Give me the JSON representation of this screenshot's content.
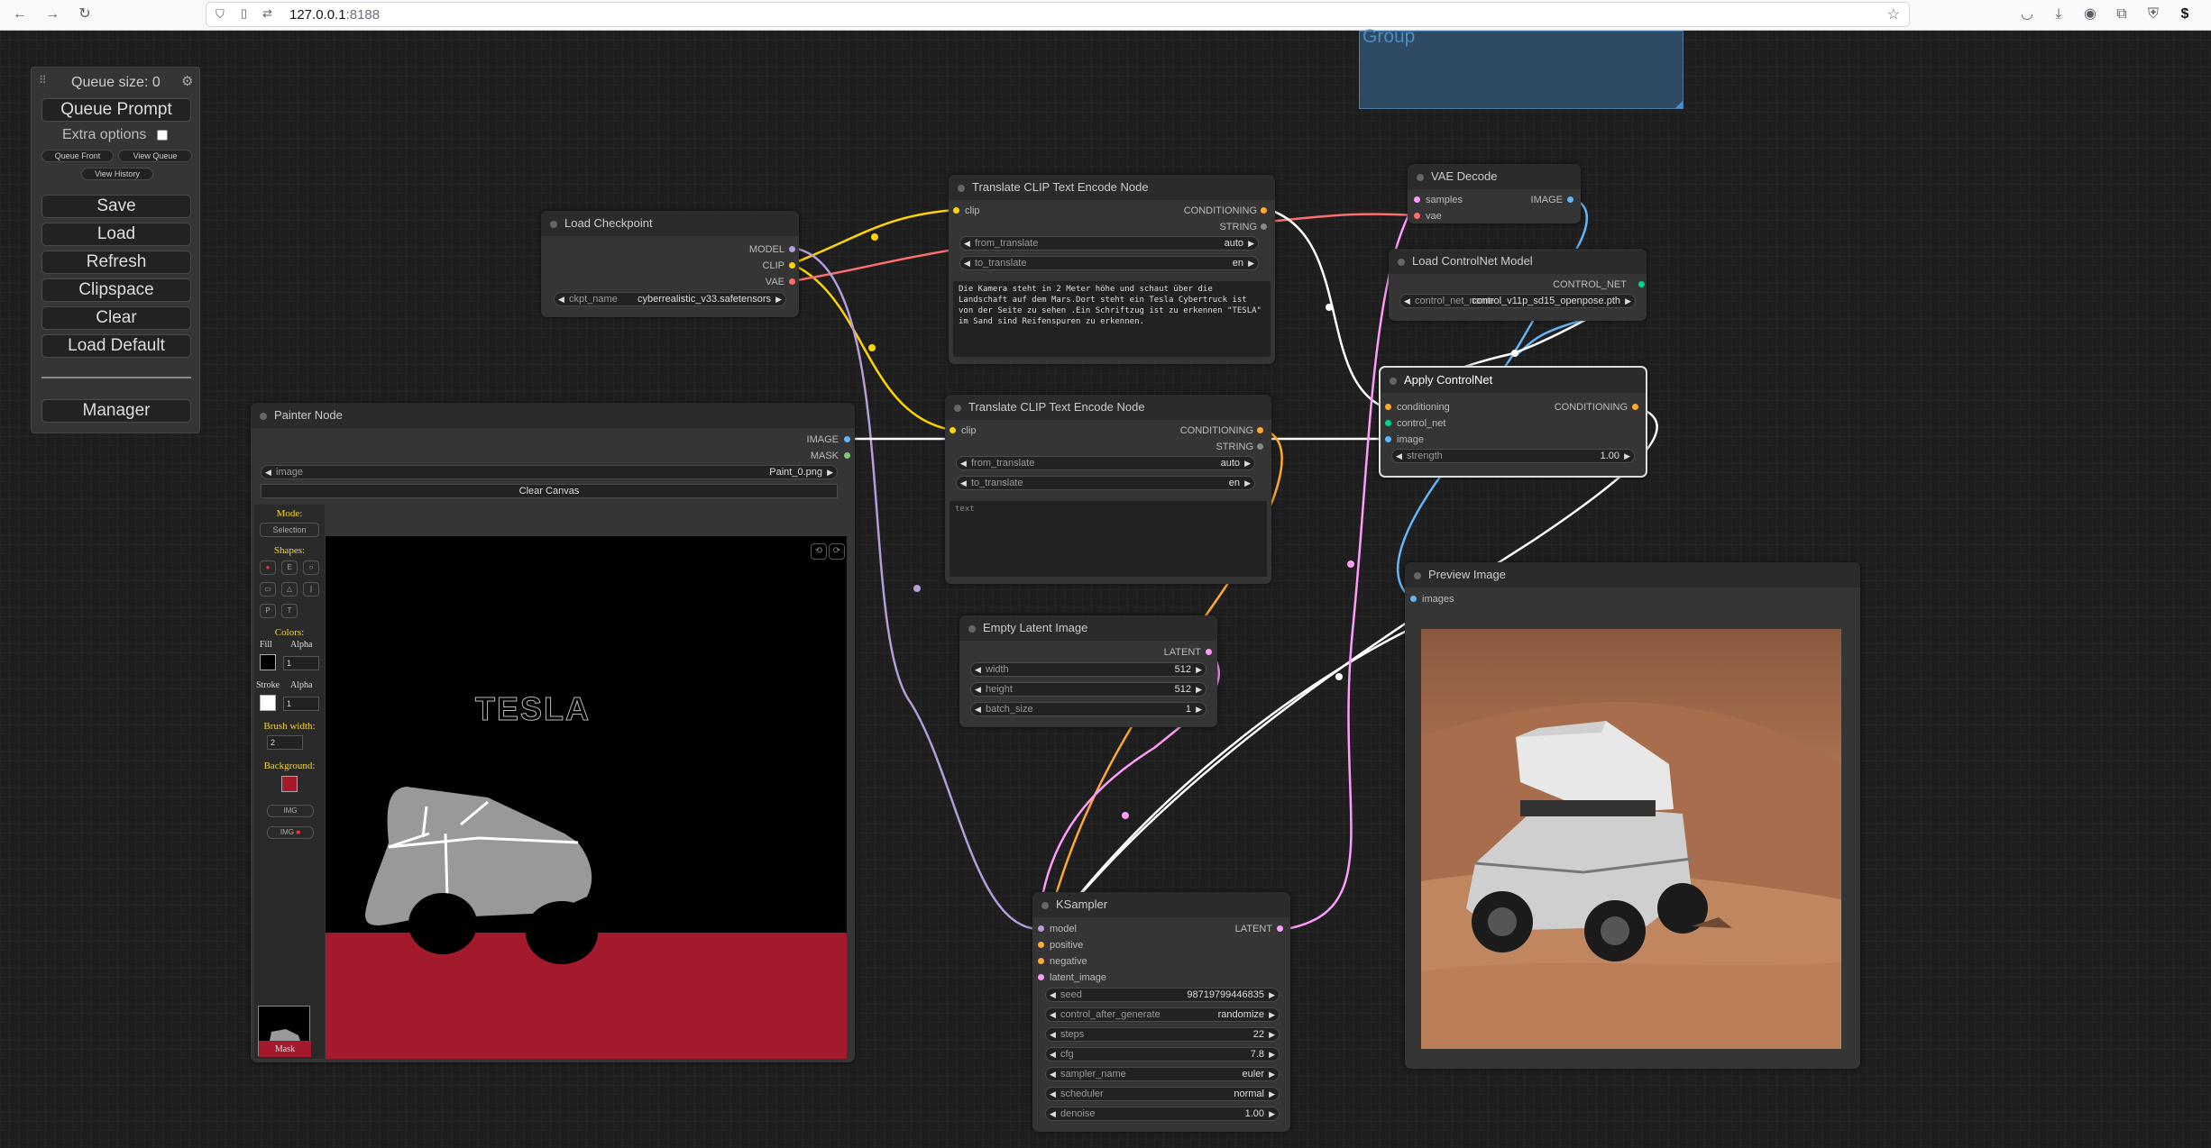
{
  "browser": {
    "url_host": "127.0.0.1",
    "url_port": ":8188",
    "back_icon": "arrow-left-icon",
    "forward_icon": "arrow-right-icon",
    "reload_icon": "reload-icon"
  },
  "group": {
    "title": "Group"
  },
  "queue": {
    "size_label": "Queue size: 0",
    "queue_prompt": "Queue Prompt",
    "extra_options": "Extra options",
    "queue_front": "Queue Front",
    "view_queue": "View Queue",
    "view_history": "View History",
    "save": "Save",
    "load": "Load",
    "refresh": "Refresh",
    "clipspace": "Clipspace",
    "clear": "Clear",
    "load_default": "Load Default",
    "manager": "Manager"
  },
  "load_checkpoint": {
    "title": "Load Checkpoint",
    "out_model": "MODEL",
    "out_clip": "CLIP",
    "out_vae": "VAE",
    "ckpt_label": "ckpt_name",
    "ckpt_value": "cyberrealistic_v33.safetensors"
  },
  "translate1": {
    "title": "Translate CLIP Text Encode Node",
    "in_clip": "clip",
    "out_conditioning": "CONDITIONING",
    "out_string": "STRING",
    "from_label": "from_translate",
    "from_value": "auto",
    "to_label": "to_translate",
    "to_value": "en",
    "text": "Die Kamera steht in 2 Meter höhe und schaut über die Landschaft auf dem Mars.Dort steht ein Tesla Cybertruck ist von der Seite zu sehen .Ein Schriftzug ist zu erkennen \"TESLA\" im Sand sind Reifenspuren zu erkennen."
  },
  "translate2": {
    "title": "Translate CLIP Text Encode Node",
    "in_clip": "clip",
    "out_conditioning": "CONDITIONING",
    "out_string": "STRING",
    "from_label": "from_translate",
    "from_value": "auto",
    "to_label": "to_translate",
    "to_value": "en",
    "placeholder": "text"
  },
  "vae_decode": {
    "title": "VAE Decode",
    "in_samples": "samples",
    "in_vae": "vae",
    "out_image": "IMAGE"
  },
  "controlnet_loader": {
    "title": "Load ControlNet Model",
    "out": "CONTROL_NET",
    "label": "control_net_name",
    "value": "control_v11p_sd15_openpose.pth"
  },
  "apply_controlnet": {
    "title": "Apply ControlNet",
    "in_conditioning": "conditioning",
    "in_control_net": "control_net",
    "in_image": "image",
    "out": "CONDITIONING",
    "strength_label": "strength",
    "strength_value": "1.00"
  },
  "painter": {
    "title": "Painter Node",
    "out_image": "IMAGE",
    "out_mask": "MASK",
    "image_label": "image",
    "image_value": "Paint_0.png",
    "clear_canvas": "Clear Canvas",
    "mode_label": "Mode:",
    "mode_value": "Selection",
    "shapes_label": "Shapes:",
    "colors_label": "Colors:",
    "fill_label": "Fill",
    "alpha_label": "Alpha",
    "alpha_value": "1",
    "stroke_label": "Stroke",
    "brush_label": "Brush width:",
    "brush_value": "2",
    "background_label": "Background:",
    "img_btn": "IMG",
    "img_btn2": "IMG",
    "canvas_text": "TESLA",
    "mask_label": "Mask"
  },
  "empty_latent": {
    "title": "Empty Latent Image",
    "out": "LATENT",
    "width_label": "width",
    "width_value": "512",
    "height_label": "height",
    "height_value": "512",
    "batch_label": "batch_size",
    "batch_value": "1"
  },
  "preview": {
    "title": "Preview Image",
    "in_images": "images"
  },
  "ksampler": {
    "title": "KSampler",
    "in_model": "model",
    "in_positive": "positive",
    "in_negative": "negative",
    "in_latent": "latent_image",
    "out": "LATENT",
    "widgets": [
      {
        "label": "seed",
        "value": "987197994468​35"
      },
      {
        "label": "control_after_generate",
        "value": "randomize"
      },
      {
        "label": "steps",
        "value": "22"
      },
      {
        "label": "cfg",
        "value": "7.8"
      },
      {
        "label": "sampler_name",
        "value": "euler"
      },
      {
        "label": "scheduler",
        "value": "normal"
      },
      {
        "label": "denoise",
        "value": "1.00"
      }
    ]
  },
  "colors": {
    "model": "#b39ddb",
    "clip": "#ffd500",
    "vae": "#ff6e6e",
    "conditioning": "#ffa931",
    "image": "#64b5f6",
    "latent": "#ff9cf9",
    "control_net": "#00d78d",
    "mask": "#81c784"
  }
}
